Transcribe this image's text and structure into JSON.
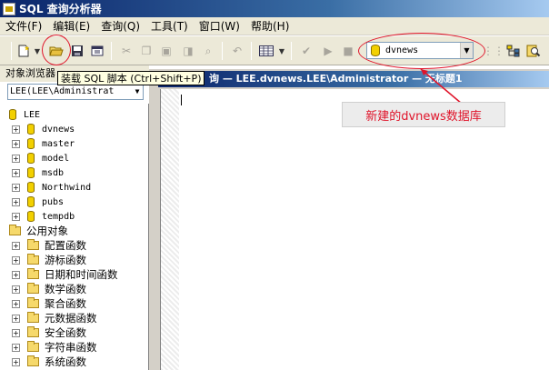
{
  "window": {
    "title": "SQL 查询分析器"
  },
  "menu": [
    "文件(F)",
    "编辑(E)",
    "查询(Q)",
    "工具(T)",
    "窗口(W)",
    "帮助(H)"
  ],
  "toolbar": {
    "database": "dvnews",
    "tooltip": "装载 SQL 脚本 (Ctrl+Shift+P)"
  },
  "object_browser": {
    "header": "对象浏览器",
    "server_select": "LEE(LEE\\Administrat",
    "root": "LEE",
    "databases": [
      "dvnews",
      "master",
      "model",
      "msdb",
      "Northwind",
      "pubs",
      "tempdb"
    ],
    "common_objects": "公用对象",
    "function_groups": [
      "配置函数",
      "游标函数",
      "日期和时间函数",
      "数学函数",
      "聚合函数",
      "元数据函数",
      "安全函数",
      "字符串函数",
      "系统函数"
    ]
  },
  "editor": {
    "title": "询 — LEE.dvnews.LEE\\Administrator — 无标题1"
  },
  "annotation": {
    "text": "新建的dvnews数据库",
    "color": "#e0142a"
  }
}
